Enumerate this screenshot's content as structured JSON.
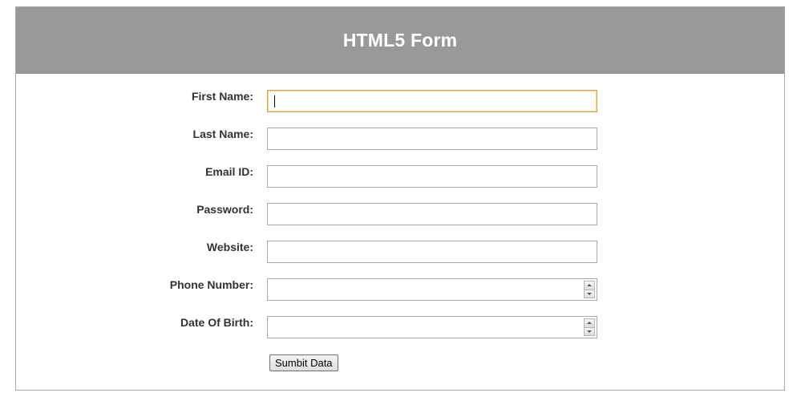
{
  "form": {
    "title": "HTML5 Form",
    "fields": [
      {
        "label": "First Name:",
        "value": ""
      },
      {
        "label": "Last Name:",
        "value": ""
      },
      {
        "label": "Email ID:",
        "value": ""
      },
      {
        "label": "Password:",
        "value": ""
      },
      {
        "label": "Website:",
        "value": ""
      },
      {
        "label": "Phone Number:",
        "value": ""
      },
      {
        "label": "Date Of Birth:",
        "value": ""
      }
    ],
    "submit_label": "Sumbit Data"
  },
  "colors": {
    "header_background": "#999999",
    "focus_border": "#e0a33a"
  },
  "icons": {
    "spinner_up": "spin-up-icon",
    "spinner_down": "spin-down-icon"
  }
}
